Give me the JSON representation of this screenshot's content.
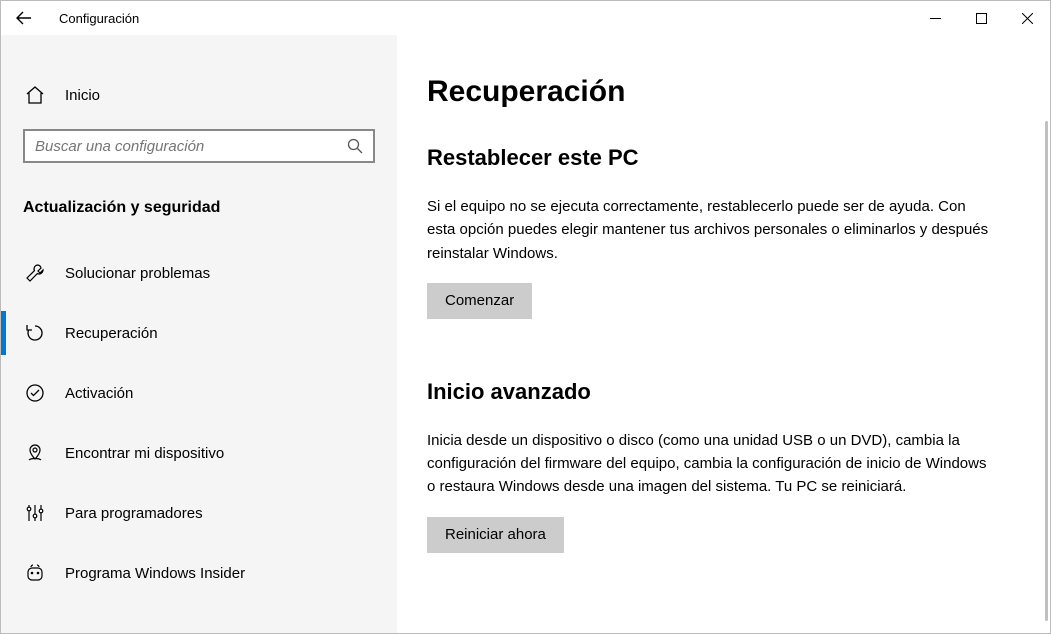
{
  "titlebar": {
    "title": "Configuración"
  },
  "sidebar": {
    "home_label": "Inicio",
    "search_placeholder": "Buscar una configuración",
    "section_title": "Actualización y seguridad",
    "items": [
      {
        "label": "Solucionar problemas",
        "icon": "wrench-icon",
        "selected": false
      },
      {
        "label": "Recuperación",
        "icon": "refresh-icon",
        "selected": true
      },
      {
        "label": "Activación",
        "icon": "check-circle-icon",
        "selected": false
      },
      {
        "label": "Encontrar mi dispositivo",
        "icon": "location-pin-icon",
        "selected": false
      },
      {
        "label": "Para programadores",
        "icon": "sliders-icon",
        "selected": false
      },
      {
        "label": "Programa Windows Insider",
        "icon": "insider-icon",
        "selected": false
      }
    ]
  },
  "content": {
    "page_title": "Recuperación",
    "sections": [
      {
        "heading": "Restablecer este PC",
        "body": "Si el equipo no se ejecuta correctamente, restablecerlo puede ser de ayuda. Con esta opción puedes elegir mantener tus archivos personales o eliminarlos y después reinstalar Windows.",
        "button": "Comenzar"
      },
      {
        "heading": "Inicio avanzado",
        "body": "Inicia desde un dispositivo o disco (como una unidad USB o un DVD), cambia la configuración del firmware del equipo, cambia la configuración de inicio de Windows o restaura Windows desde una imagen del sistema. Tu PC se reiniciará.",
        "button": "Reiniciar ahora"
      }
    ]
  }
}
